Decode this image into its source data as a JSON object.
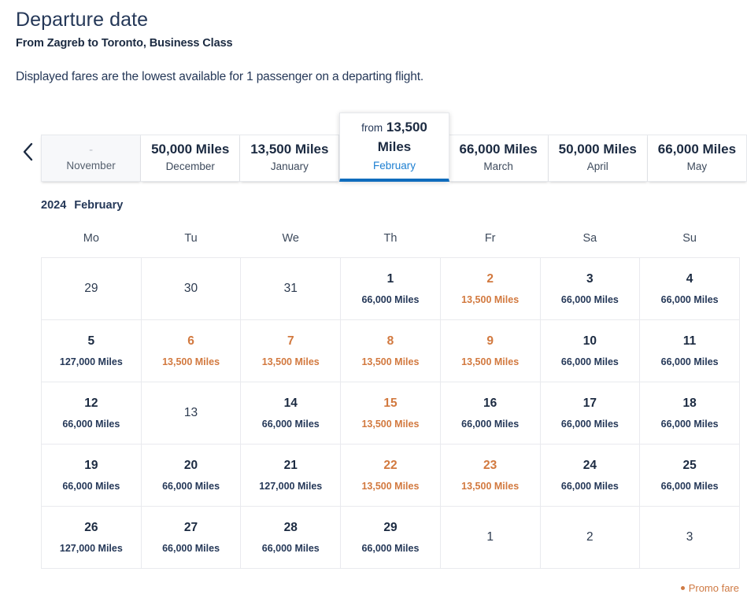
{
  "header": {
    "title": "Departure date",
    "route": "From Zagreb to Toronto, Business Class",
    "note": "Displayed fares are the lowest available for 1 passenger on a departing flight."
  },
  "nav": {
    "prev_label": "‹",
    "prev_icon": "chevron-left-icon"
  },
  "month_tabs": [
    {
      "price": "-",
      "month": "November",
      "state": "disabled"
    },
    {
      "price": "50,000 Miles",
      "month": "December",
      "state": "normal"
    },
    {
      "price": "13,500 Miles",
      "month": "January",
      "state": "normal"
    },
    {
      "from_word": "from",
      "price": "13,500 Miles",
      "month": "February",
      "state": "active"
    },
    {
      "price": "66,000 Miles",
      "month": "March",
      "state": "normal"
    },
    {
      "price": "50,000 Miles",
      "month": "April",
      "state": "normal"
    },
    {
      "price": "66,000 Miles",
      "month": "May",
      "state": "normal"
    }
  ],
  "calendar": {
    "year": "2024",
    "month": "February",
    "weekdays": [
      "Mo",
      "Tu",
      "We",
      "Th",
      "Fr",
      "Sa",
      "Su"
    ],
    "weeks": [
      [
        {
          "day": "29",
          "fare": "",
          "state": "muted"
        },
        {
          "day": "30",
          "fare": "",
          "state": "muted"
        },
        {
          "day": "31",
          "fare": "",
          "state": "muted"
        },
        {
          "day": "1",
          "fare": "66,000 Miles",
          "state": "normal"
        },
        {
          "day": "2",
          "fare": "13,500 Miles",
          "state": "promo"
        },
        {
          "day": "3",
          "fare": "66,000 Miles",
          "state": "normal"
        },
        {
          "day": "4",
          "fare": "66,000 Miles",
          "state": "normal"
        }
      ],
      [
        {
          "day": "5",
          "fare": "127,000 Miles",
          "state": "normal"
        },
        {
          "day": "6",
          "fare": "13,500 Miles",
          "state": "promo"
        },
        {
          "day": "7",
          "fare": "13,500 Miles",
          "state": "promo"
        },
        {
          "day": "8",
          "fare": "13,500 Miles",
          "state": "promo"
        },
        {
          "day": "9",
          "fare": "13,500 Miles",
          "state": "promo"
        },
        {
          "day": "10",
          "fare": "66,000 Miles",
          "state": "normal"
        },
        {
          "day": "11",
          "fare": "66,000 Miles",
          "state": "normal"
        }
      ],
      [
        {
          "day": "12",
          "fare": "66,000 Miles",
          "state": "normal"
        },
        {
          "day": "13",
          "fare": "",
          "state": "muted"
        },
        {
          "day": "14",
          "fare": "66,000 Miles",
          "state": "normal"
        },
        {
          "day": "15",
          "fare": "13,500 Miles",
          "state": "promo"
        },
        {
          "day": "16",
          "fare": "66,000 Miles",
          "state": "normal"
        },
        {
          "day": "17",
          "fare": "66,000 Miles",
          "state": "normal"
        },
        {
          "day": "18",
          "fare": "66,000 Miles",
          "state": "normal"
        }
      ],
      [
        {
          "day": "19",
          "fare": "66,000 Miles",
          "state": "normal"
        },
        {
          "day": "20",
          "fare": "66,000 Miles",
          "state": "normal"
        },
        {
          "day": "21",
          "fare": "127,000 Miles",
          "state": "normal"
        },
        {
          "day": "22",
          "fare": "13,500 Miles",
          "state": "promo"
        },
        {
          "day": "23",
          "fare": "13,500 Miles",
          "state": "promo"
        },
        {
          "day": "24",
          "fare": "66,000 Miles",
          "state": "normal"
        },
        {
          "day": "25",
          "fare": "66,000 Miles",
          "state": "normal"
        }
      ],
      [
        {
          "day": "26",
          "fare": "127,000 Miles",
          "state": "normal"
        },
        {
          "day": "27",
          "fare": "66,000 Miles",
          "state": "normal"
        },
        {
          "day": "28",
          "fare": "66,000 Miles",
          "state": "normal"
        },
        {
          "day": "29",
          "fare": "66,000 Miles",
          "state": "normal"
        },
        {
          "day": "1",
          "fare": "",
          "state": "muted"
        },
        {
          "day": "2",
          "fare": "",
          "state": "muted"
        },
        {
          "day": "3",
          "fare": "",
          "state": "muted"
        }
      ]
    ]
  },
  "legend": {
    "promo_label": "Promo fare"
  },
  "colors": {
    "promo": "#d2793f",
    "accent": "#0f6cbd",
    "text": "#1b2a41",
    "active_month": "#1d7fd1"
  }
}
